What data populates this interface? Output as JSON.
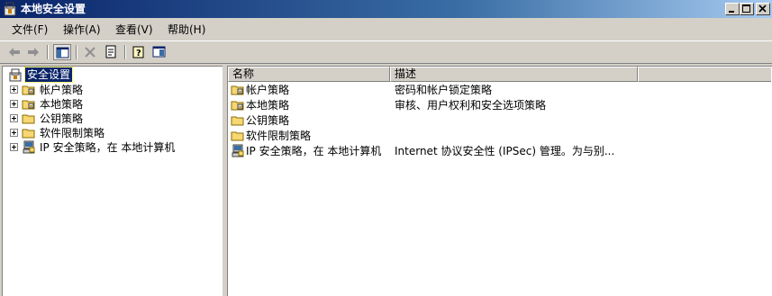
{
  "window": {
    "title": "本地安全设置",
    "title_icon": "security-settings-icon",
    "controls": [
      "minimize-icon",
      "maximize-icon",
      "close-icon"
    ]
  },
  "menu": {
    "items": [
      {
        "label": "文件(F)"
      },
      {
        "label": "操作(A)"
      },
      {
        "label": "查看(V)"
      },
      {
        "label": "帮助(H)"
      }
    ]
  },
  "toolbar": {
    "buttons": [
      "back-icon",
      "forward-icon",
      "show-hide-tree-icon",
      "delete-icon",
      "properties-icon",
      "help-icon",
      "console-icon"
    ]
  },
  "tree": {
    "root": {
      "label": "安全设置",
      "icon": "security-settings-icon",
      "selected": true
    },
    "items": [
      {
        "label": "帐户策略",
        "icon": "policy-folder-icon"
      },
      {
        "label": "本地策略",
        "icon": "policy-folder-icon"
      },
      {
        "label": "公钥策略",
        "icon": "folder-icon"
      },
      {
        "label": "软件限制策略",
        "icon": "folder-icon"
      },
      {
        "label": "IP 安全策略，在 本地计算机",
        "icon": "ip-security-icon"
      }
    ]
  },
  "list": {
    "columns": [
      "名称",
      "描述"
    ],
    "rows": [
      {
        "name": "帐户策略",
        "description": "密码和帐户锁定策略",
        "icon": "policy-folder-icon"
      },
      {
        "name": "本地策略",
        "description": "审核、用户权利和安全选项策略",
        "icon": "policy-folder-icon"
      },
      {
        "name": "公钥策略",
        "description": "",
        "icon": "folder-icon"
      },
      {
        "name": "软件限制策略",
        "description": "",
        "icon": "folder-icon"
      },
      {
        "name": "IP 安全策略，在 本地计算机",
        "description": "Internet 协议安全性 (IPSec) 管理。为与别...",
        "icon": "ip-security-icon"
      }
    ]
  },
  "colors": {
    "title_start": "#0a246a",
    "title_end": "#a6caf0",
    "selection": "#0a246a",
    "chrome": "#d4d0c8",
    "folder": "#f7d774"
  }
}
